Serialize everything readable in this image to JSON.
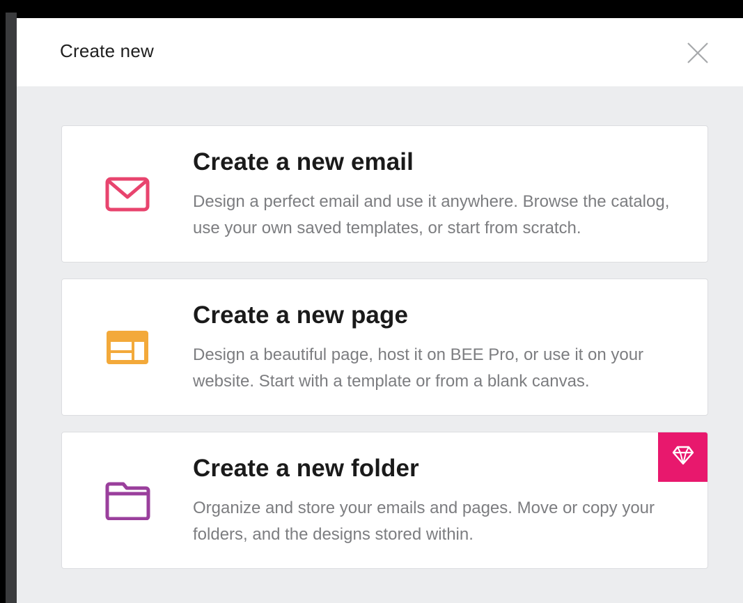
{
  "modal": {
    "title": "Create new",
    "close_icon": "close-icon"
  },
  "options": [
    {
      "icon": "envelope-icon",
      "icon_color": "#e8446e",
      "title": "Create a new email",
      "description": "Design a perfect email and use it anywhere. Browse the catalog, use your own saved templates, or start from scratch."
    },
    {
      "icon": "page-layout-icon",
      "icon_color": "#f3a93a",
      "title": "Create a new page",
      "description": "Design a beautiful page, host it on BEE Pro, or use it on your website. Start with a template or from a blank canvas."
    },
    {
      "icon": "folder-icon",
      "icon_color": "#9a3f9c",
      "title": "Create a new folder",
      "description": "Organize and store your emails and pages. Move or copy your folders, and the designs stored within.",
      "badge_icon": "diamond-icon",
      "badge_color": "#e8186d"
    }
  ]
}
